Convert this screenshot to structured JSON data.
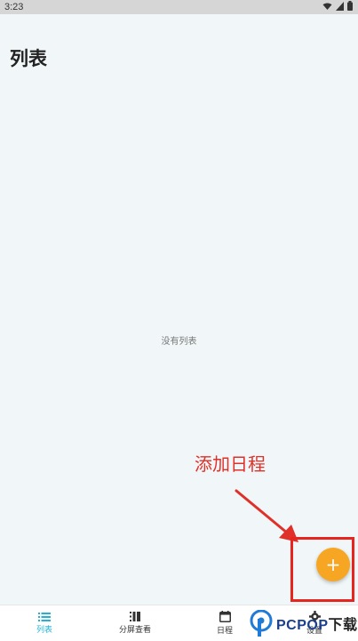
{
  "statusbar": {
    "time": "3:23",
    "icons": [
      "wifi-icon",
      "signal-icon",
      "battery-icon"
    ]
  },
  "header": {
    "title": "列表"
  },
  "main": {
    "empty_text": "没有列表"
  },
  "annotation": {
    "text": "添加日程",
    "color": "#e0302a"
  },
  "fab": {
    "label": "+",
    "color": "#f6a623"
  },
  "bottom_nav": {
    "accent": "#22b2d6",
    "items": [
      {
        "label": "列表",
        "icon": "list-icon",
        "active": true
      },
      {
        "label": "分屏查看",
        "icon": "split-view-icon",
        "active": false
      },
      {
        "label": "日程",
        "icon": "calendar-icon",
        "active": false
      },
      {
        "label": "设置",
        "icon": "gear-icon",
        "active": false
      }
    ]
  },
  "watermark": {
    "brand": "PCPOP",
    "suffix": "下载"
  }
}
